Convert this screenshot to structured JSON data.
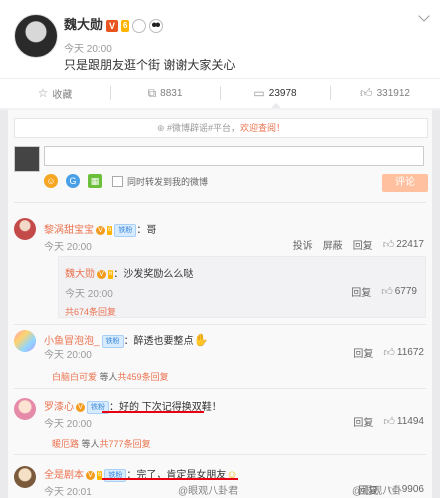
{
  "post": {
    "author": "魏大勋",
    "verified": "V",
    "level": "6",
    "time": "今天 20:00",
    "text": "只是跟朋友逛个街 谢谢大家关心",
    "actions": {
      "favorite": "收藏",
      "repost": "8831",
      "comment": "23978",
      "like": "331912"
    }
  },
  "notice": {
    "prefix": "#微博辟谣#平台，",
    "link": "欢迎查阅！"
  },
  "compose": {
    "placeholder": "",
    "checkbox_label": "同时转发到我的微博",
    "submit": "评论"
  },
  "comments": [
    {
      "name": "黎涡甜宝宝",
      "tag": "铁粉",
      "text": "：哥",
      "time": "今天 20:00",
      "report": "投诉",
      "block": "屏蔽",
      "reply": "回复",
      "likes": "22417",
      "sub": {
        "name": "魏大勋",
        "text": "：沙发奖励么么哒",
        "time": "今天 20:00",
        "reply": "回复",
        "likes": "6779"
      },
      "more": "共674条回复"
    },
    {
      "name": "小鱼冒泡泡_",
      "tag": "铁粉",
      "text": "：醉透也要整点",
      "time": "今天 20:00",
      "reply": "回复",
      "likes": "11672",
      "more_user": "白脑白可爱",
      "more_mid": "等人",
      "more_count": "共459条回复"
    },
    {
      "name": "罗漆心",
      "tag": "铁粉",
      "text": "：好的 下次记得换双鞋！",
      "time": "今天 20:00",
      "reply": "回复",
      "likes": "11494",
      "more_user": "暖厄路",
      "more_mid": "等人",
      "more_count": "共777条回复"
    },
    {
      "name": "全是剧本",
      "tag": "铁粉",
      "text": "：完了，肯定是女朋友",
      "time": "今天 20:01",
      "reply": "回复",
      "likes": "9906"
    }
  ],
  "watermark": {
    "left": "@眼观八卦君",
    "right": "@眼观八卦"
  },
  "colors": {
    "accent": "#eb7350",
    "highlight_underline": "#e60012",
    "tag_blue": "#3a88d8"
  }
}
